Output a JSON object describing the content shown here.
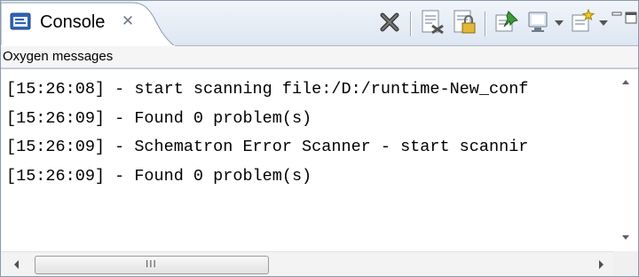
{
  "tab": {
    "label": "Console",
    "close_glyph": "✕",
    "icon": "console-icon"
  },
  "toolbar": {
    "buttons": [
      {
        "name": "remove-all-terminated-button",
        "icon": "close-x-icon"
      },
      {
        "name": "clear-console-button",
        "icon": "clear-console-icon"
      },
      {
        "name": "scroll-lock-button",
        "icon": "scroll-lock-icon"
      },
      {
        "name": "pin-console-button",
        "icon": "pin-icon"
      },
      {
        "name": "display-selected-console-button",
        "icon": "monitor-icon"
      },
      {
        "name": "open-console-button",
        "icon": "new-console-icon"
      }
    ]
  },
  "description": "Oxygen messages",
  "console_lines": [
    "[15:26:08] - start scanning file:/D:/runtime-New_conf",
    "[15:26:09] - Found 0 problem(s)",
    "[15:26:09] - Schematron Error Scanner - start scannir",
    "[15:26:09] - Found 0 problem(s)"
  ],
  "scrollbar": {
    "grip": "III"
  },
  "colors": {
    "accent": "#2f64b4",
    "border": "#8a99ad",
    "tabstrip": "#dde6f2"
  }
}
